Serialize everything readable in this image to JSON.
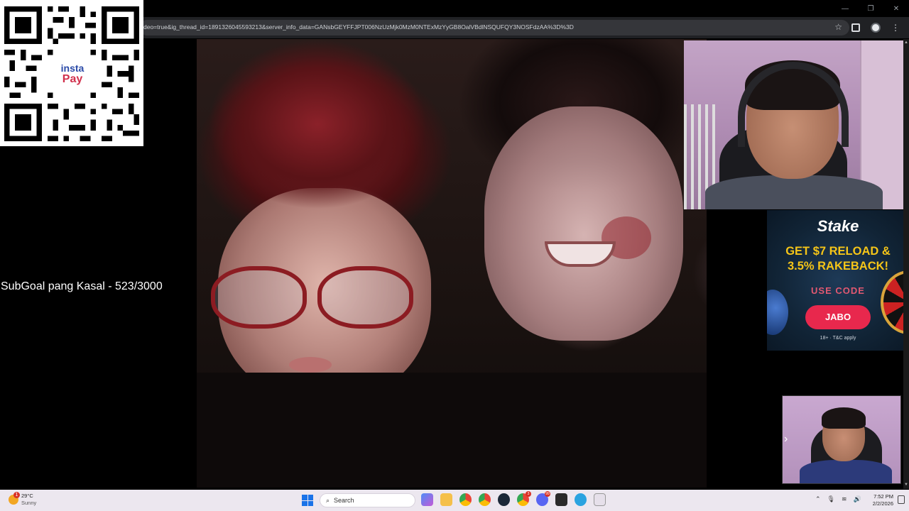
{
  "browser": {
    "url": "deo=true&ig_thread_id=1891326045593213&server_info_data=GANsbGEYFFJPT006NzUzMjk0MzM0NTExMzYyGB8OalVBdlNSQUFQY3NOSFdzAA%3D%3D",
    "window_controls": {
      "minimize": "—",
      "maximize": "❐",
      "close": "✕"
    }
  },
  "qr_panel": {
    "logo_line1": "insta",
    "logo_line2": "Pay"
  },
  "overlay": {
    "subgoal_text": "SubGoal pang Kasal - 523/3000"
  },
  "ad": {
    "brand": "Stake",
    "headline_line1": "GET $7 RELOAD &",
    "headline_line2": "3.5% RAKEBACK!",
    "use_code_label": "USE CODE",
    "code": "JABO",
    "fineprint": "18+ · T&C apply"
  },
  "taskbar": {
    "weather_temp": "29°C",
    "weather_cond": "Sunny",
    "weather_badge": "1",
    "search_placeholder": "Search",
    "time": "7:52 PM",
    "date": "2/2/2026",
    "app_badges": {
      "chrome2": "3",
      "discord": "99"
    }
  },
  "colors": {
    "taskbar_bg": "#ece7ef",
    "accent": "#1a73e8",
    "ad_button": "#e8284d",
    "ad_headline": "#f5c518"
  }
}
